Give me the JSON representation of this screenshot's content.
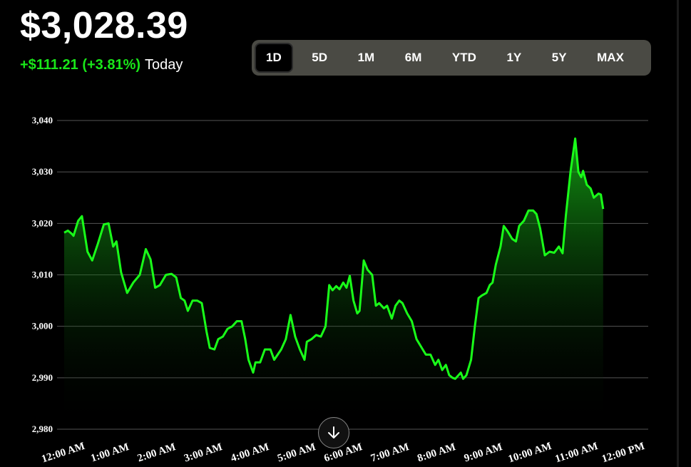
{
  "header": {
    "price": "$3,028.39",
    "change": "+$111.21 (+3.81%)",
    "period": "Today"
  },
  "range_tabs": [
    {
      "label": "1D",
      "active": true
    },
    {
      "label": "5D",
      "active": false
    },
    {
      "label": "1M",
      "active": false
    },
    {
      "label": "6M",
      "active": false
    },
    {
      "label": "YTD",
      "active": false
    },
    {
      "label": "1Y",
      "active": false
    },
    {
      "label": "5Y",
      "active": false
    },
    {
      "label": "MAX",
      "active": false
    }
  ],
  "colors": {
    "line": "#19ff19",
    "positive_text": "#19e619",
    "grid": "#555555",
    "tab_bar": "#4a4a44"
  },
  "icons": {
    "scroll_down": "arrow-down-icon"
  },
  "chart_data": {
    "type": "area",
    "ylim": [
      2980,
      3040
    ],
    "yticks": [
      "3,040",
      "3,030",
      "3,020",
      "3,010",
      "3,000",
      "2,990",
      "2,980"
    ],
    "ytick_values": [
      3040,
      3030,
      3020,
      3010,
      3000,
      2990,
      2980
    ],
    "xticks": [
      "12:00 AM",
      "1:00 AM",
      "2:00 AM",
      "3:00 AM",
      "4:00 AM",
      "5:00 AM",
      "6:00 AM",
      "7:00 AM",
      "8:00 AM",
      "9:00 AM",
      "10:00 AM",
      "11:00 AM",
      "12:00 PM"
    ],
    "xlim_hours": [
      0,
      12.5
    ],
    "series": [
      {
        "points": [
          [
            0.0,
            3018.2
          ],
          [
            0.08,
            3018.6
          ],
          [
            0.16,
            3018.0
          ],
          [
            0.2,
            3017.6
          ],
          [
            0.3,
            3020.5
          ],
          [
            0.38,
            3021.4
          ],
          [
            0.5,
            3014.5
          ],
          [
            0.6,
            3012.8
          ],
          [
            0.72,
            3016.0
          ],
          [
            0.85,
            3019.8
          ],
          [
            0.95,
            3020.0
          ],
          [
            1.05,
            3015.5
          ],
          [
            1.12,
            3016.5
          ],
          [
            1.22,
            3010.5
          ],
          [
            1.35,
            3006.5
          ],
          [
            1.48,
            3008.5
          ],
          [
            1.62,
            3010.0
          ],
          [
            1.75,
            3015.0
          ],
          [
            1.85,
            3013.0
          ],
          [
            1.95,
            3007.5
          ],
          [
            2.05,
            3008.0
          ],
          [
            2.18,
            3010.0
          ],
          [
            2.3,
            3010.2
          ],
          [
            2.4,
            3009.5
          ],
          [
            2.5,
            3005.5
          ],
          [
            2.58,
            3005.0
          ],
          [
            2.65,
            3003.0
          ],
          [
            2.75,
            3005.0
          ],
          [
            2.85,
            3005.0
          ],
          [
            2.95,
            3004.5
          ],
          [
            3.05,
            2999.0
          ],
          [
            3.12,
            2995.8
          ],
          [
            3.22,
            2995.5
          ],
          [
            3.3,
            2997.5
          ],
          [
            3.4,
            2998.0
          ],
          [
            3.5,
            2999.5
          ],
          [
            3.6,
            3000.0
          ],
          [
            3.7,
            3001.0
          ],
          [
            3.8,
            3001.0
          ],
          [
            3.88,
            2997.5
          ],
          [
            3.95,
            2993.5
          ],
          [
            4.05,
            2991.0
          ],
          [
            4.1,
            2993.0
          ],
          [
            4.2,
            2993.0
          ],
          [
            4.3,
            2995.5
          ],
          [
            4.42,
            2995.5
          ],
          [
            4.5,
            2993.5
          ],
          [
            4.65,
            2995.5
          ],
          [
            4.75,
            2997.5
          ],
          [
            4.85,
            3002.2
          ],
          [
            4.95,
            2998.0
          ],
          [
            5.05,
            2995.5
          ],
          [
            5.15,
            2993.5
          ],
          [
            5.2,
            2997.0
          ],
          [
            5.3,
            2997.5
          ],
          [
            5.4,
            2998.3
          ],
          [
            5.5,
            2998.0
          ],
          [
            5.6,
            3000.0
          ],
          [
            5.68,
            3008.0
          ],
          [
            5.75,
            3007.0
          ],
          [
            5.83,
            3007.8
          ],
          [
            5.9,
            3007.2
          ],
          [
            5.98,
            3008.5
          ],
          [
            6.05,
            3007.5
          ],
          [
            6.12,
            3009.8
          ],
          [
            6.2,
            3005.0
          ],
          [
            6.28,
            3002.5
          ],
          [
            6.33,
            3003.0
          ],
          [
            6.42,
            3012.8
          ],
          [
            6.5,
            3011.0
          ],
          [
            6.6,
            3010.0
          ],
          [
            6.68,
            3004.0
          ],
          [
            6.75,
            3004.5
          ],
          [
            6.85,
            3003.5
          ],
          [
            6.92,
            3004.0
          ],
          [
            7.02,
            3001.5
          ],
          [
            7.1,
            3004.0
          ],
          [
            7.18,
            3005.0
          ],
          [
            7.25,
            3004.5
          ],
          [
            7.35,
            3002.5
          ],
          [
            7.45,
            3001.0
          ],
          [
            7.55,
            2997.5
          ],
          [
            7.65,
            2996.0
          ],
          [
            7.75,
            2994.5
          ],
          [
            7.85,
            2994.5
          ],
          [
            7.95,
            2992.5
          ],
          [
            8.02,
            2993.5
          ],
          [
            8.1,
            2991.5
          ],
          [
            8.18,
            2992.5
          ],
          [
            8.25,
            2990.5
          ],
          [
            8.32,
            2990.0
          ],
          [
            8.38,
            2989.8
          ],
          [
            8.45,
            2990.5
          ],
          [
            8.5,
            2991.0
          ],
          [
            8.55,
            2989.8
          ],
          [
            8.62,
            2990.5
          ],
          [
            8.72,
            2993.5
          ],
          [
            8.8,
            3000.0
          ],
          [
            8.88,
            3005.5
          ],
          [
            8.95,
            3006.0
          ],
          [
            9.05,
            3006.5
          ],
          [
            9.12,
            3008.0
          ],
          [
            9.18,
            3008.5
          ],
          [
            9.25,
            3012.0
          ],
          [
            9.35,
            3015.5
          ],
          [
            9.42,
            3019.5
          ],
          [
            9.5,
            3018.5
          ],
          [
            9.6,
            3017.0
          ],
          [
            9.68,
            3016.5
          ],
          [
            9.75,
            3019.5
          ],
          [
            9.85,
            3020.5
          ],
          [
            9.95,
            3022.5
          ],
          [
            10.05,
            3022.5
          ],
          [
            10.12,
            3021.8
          ],
          [
            10.2,
            3019.0
          ],
          [
            10.3,
            3013.8
          ],
          [
            10.4,
            3014.5
          ],
          [
            10.5,
            3014.3
          ],
          [
            10.6,
            3015.5
          ],
          [
            10.68,
            3014.2
          ],
          [
            10.75,
            3021.5
          ],
          [
            10.85,
            3030.0
          ],
          [
            10.95,
            3036.5
          ],
          [
            11.02,
            3030.0
          ],
          [
            11.08,
            3029.0
          ],
          [
            11.12,
            3030.2
          ],
          [
            11.2,
            3027.5
          ],
          [
            11.28,
            3026.8
          ],
          [
            11.35,
            3025.0
          ],
          [
            11.45,
            3025.8
          ],
          [
            11.5,
            3025.6
          ],
          [
            11.55,
            3022.8
          ]
        ]
      }
    ]
  }
}
